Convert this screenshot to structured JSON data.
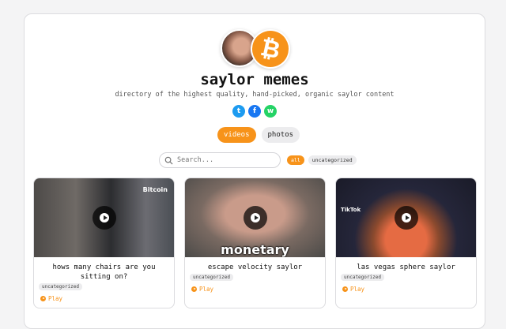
{
  "header": {
    "title": "saylor memes",
    "subtitle": "directory of the highest quality, hand-picked, organic saylor content",
    "btc_symbol": "₿"
  },
  "share": {
    "twitter": "t",
    "facebook": "f",
    "whatsapp": "w"
  },
  "tabs": [
    {
      "label": "videos",
      "active": true
    },
    {
      "label": "photos",
      "active": false
    }
  ],
  "search": {
    "placeholder": "Search...",
    "value": ""
  },
  "filters": [
    {
      "label": "all",
      "active": true
    },
    {
      "label": "uncategorized",
      "active": false
    }
  ],
  "videos": [
    {
      "title": "hows many chairs are you sitting on?",
      "tag": "uncategorized",
      "play": "Play",
      "overlay": "Bitcoin"
    },
    {
      "title": "escape velocity saylor",
      "tag": "uncategorized",
      "play": "Play",
      "overlay": "monetary"
    },
    {
      "title": "las vegas sphere saylor",
      "tag": "uncategorized",
      "play": "Play",
      "overlay": "TikTok"
    }
  ],
  "colors": {
    "accent": "#f7931a",
    "twitter": "#1d9bf0",
    "facebook": "#1877f2",
    "whatsapp": "#25d366"
  }
}
